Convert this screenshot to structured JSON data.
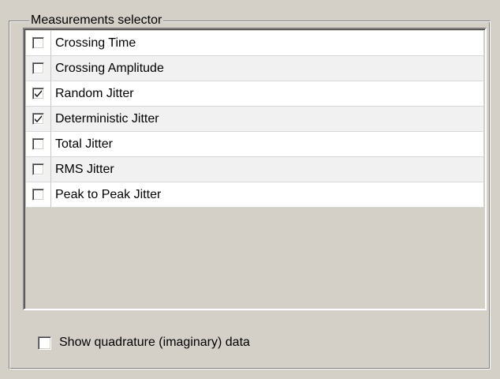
{
  "group": {
    "title": "Measurements selector"
  },
  "measurements": {
    "items": [
      {
        "label": "Crossing Time",
        "checked": false
      },
      {
        "label": "Crossing Amplitude",
        "checked": false
      },
      {
        "label": "Random Jitter",
        "checked": true
      },
      {
        "label": "Deterministic Jitter",
        "checked": true
      },
      {
        "label": "Total Jitter",
        "checked": false
      },
      {
        "label": "RMS Jitter",
        "checked": false
      },
      {
        "label": "Peak to Peak Jitter",
        "checked": false
      }
    ]
  },
  "options": {
    "quadrature_label": "Show quadrature (imaginary) data",
    "quadrature_checked": false
  },
  "colors": {
    "face": "#d4d0c8",
    "row_alt": "#f1f1f1",
    "row_plain": "#ffffff"
  }
}
